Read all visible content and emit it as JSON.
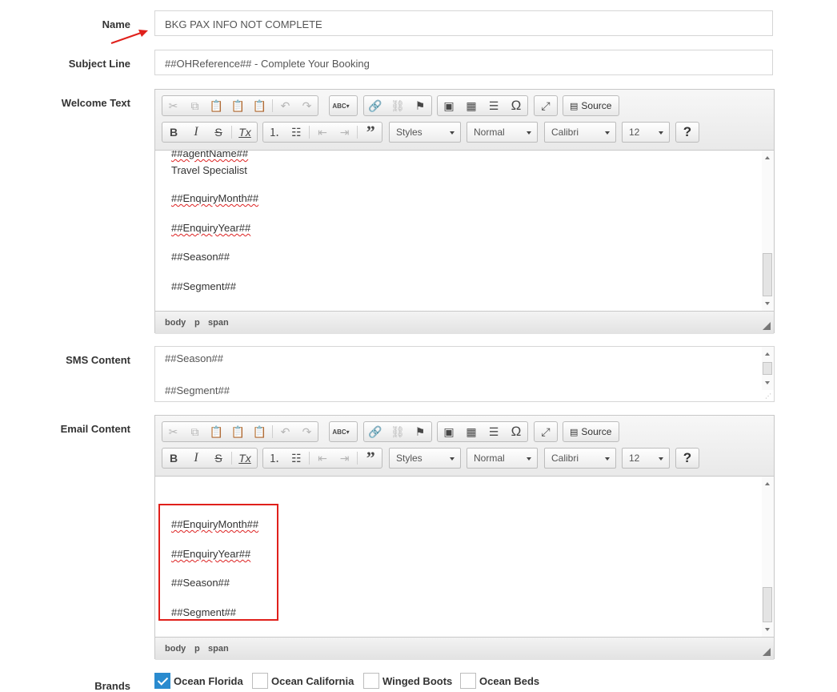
{
  "form": {
    "name_label": "Name",
    "name_value": "BKG PAX INFO NOT COMPLETE",
    "subject_label": "Subject Line",
    "subject_value": "##OHReference## - Complete Your Booking",
    "welcome_label": "Welcome Text",
    "sms_label": "SMS Content",
    "email_label": "Email Content",
    "brands_label": "Brands"
  },
  "toolbar": {
    "source_label": "Source",
    "styles": "Styles",
    "format": "Normal",
    "font": "Calibri",
    "size": "12",
    "help": "?",
    "bold": "B",
    "italic": "I",
    "strike": "S",
    "clear": "Tx",
    "quote": "”",
    "special_char": "Ω",
    "spell": "ABC"
  },
  "welcome_editor": {
    "lines": [
      "##agentName##",
      "Travel Specialist",
      "##EnquiryMonth##",
      "##EnquiryYear##",
      "##Season##",
      "##Segment##"
    ],
    "path": [
      "body",
      "p",
      "span"
    ]
  },
  "sms": {
    "lines": [
      "##Season##",
      "##Segment##"
    ]
  },
  "email_editor": {
    "lines": [
      "##EnquiryMonth##",
      "##EnquiryYear##",
      "##Season##",
      "##Segment##"
    ],
    "path": [
      "body",
      "p",
      "span"
    ]
  },
  "brands": [
    {
      "label": "Ocean Florida",
      "checked": true
    },
    {
      "label": "Ocean California",
      "checked": false
    },
    {
      "label": "Winged Boots",
      "checked": false
    },
    {
      "label": "Ocean Beds",
      "checked": false
    }
  ],
  "colors": {
    "annotation_red": "#e0201b",
    "checkbox_blue": "#2a8bcf"
  }
}
